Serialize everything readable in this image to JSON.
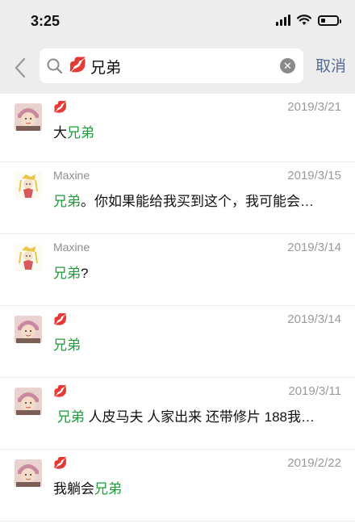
{
  "status": {
    "time": "3:25",
    "battery_level": 0.3
  },
  "search": {
    "query_emoji": "💋",
    "query": "兄弟",
    "clear_icon": "clear-icon",
    "cancel_label": "取消"
  },
  "results": [
    {
      "name": "💋",
      "date": "2019/3/21",
      "prefix": "大",
      "highlight": "兄弟",
      "suffix": "",
      "avatar": "baby"
    },
    {
      "name": "Maxine",
      "date": "2019/3/15",
      "prefix": "",
      "highlight": "兄弟",
      "suffix": "。你如果能给我买到这个，我可能会…",
      "avatar": "anime"
    },
    {
      "name": "Maxine",
      "date": "2019/3/14",
      "prefix": "",
      "highlight": "兄弟",
      "suffix": "?",
      "avatar": "anime"
    },
    {
      "name": "💋",
      "date": "2019/3/14",
      "prefix": "",
      "highlight": "兄弟",
      "suffix": "",
      "avatar": "baby"
    },
    {
      "name": "💋",
      "date": "2019/3/11",
      "prefix": " ",
      "highlight": "兄弟",
      "suffix": " 人皮马夫 人家出来 还带修片 188我…",
      "avatar": "baby"
    },
    {
      "name": "💋",
      "date": "2019/2/22",
      "prefix": "我躺会",
      "highlight": "兄弟",
      "suffix": "",
      "avatar": "baby"
    }
  ]
}
